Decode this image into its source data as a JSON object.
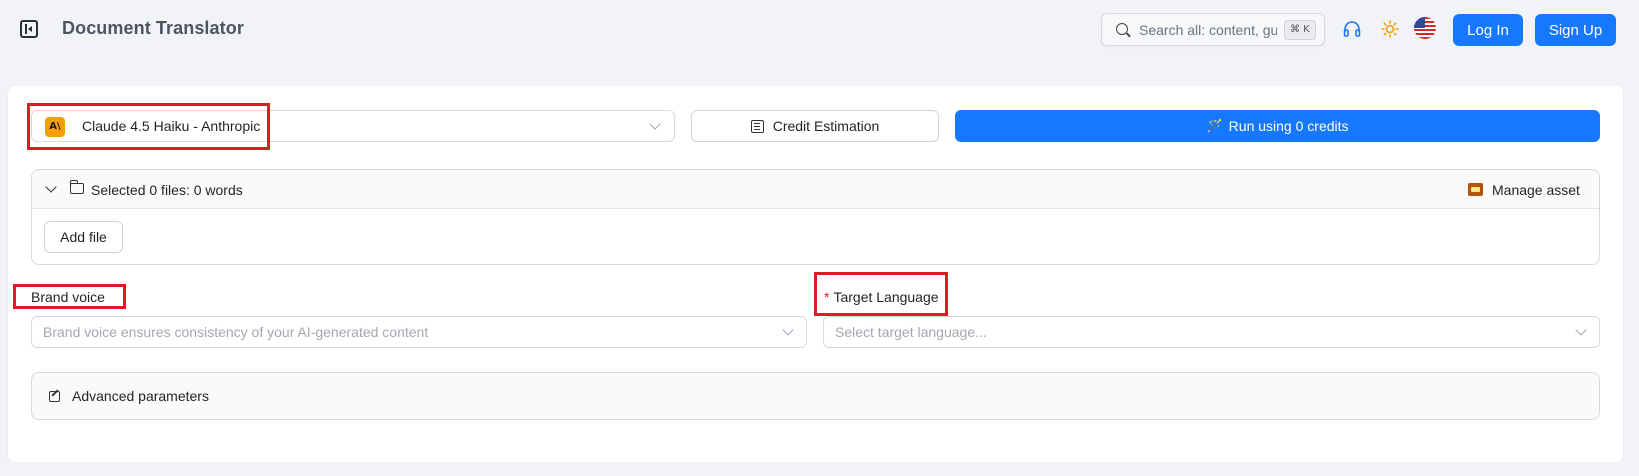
{
  "header": {
    "title": "Document Translator",
    "search_placeholder": "Search all: content, gui",
    "search_shortcut": "⌘ K",
    "login_label": "Log In",
    "signup_label": "Sign Up",
    "icons": [
      "sidebar-toggle-icon",
      "search-icon",
      "headset-icon",
      "sun-icon",
      "us-flag-icon"
    ]
  },
  "toolbar": {
    "model_label": "Claude 4.5 Haiku - Anthropic",
    "model_logo_text": "A\\",
    "credit_label": "Credit Estimation",
    "run_label": "Run using 0 credits"
  },
  "files": {
    "summary": "Selected 0 files: 0 words",
    "manage_label": "Manage asset",
    "add_label": "Add file"
  },
  "brand_voice": {
    "label": "Brand voice",
    "placeholder": "Brand voice ensures consistency of your AI-generated content"
  },
  "target_language": {
    "required_mark": "*",
    "label": "Target Language",
    "placeholder": "Select target language..."
  },
  "advanced": {
    "label": "Advanced parameters"
  },
  "colors": {
    "primary": "#1677ff",
    "highlight": "#e01b24",
    "background": "#f2f3f6"
  }
}
